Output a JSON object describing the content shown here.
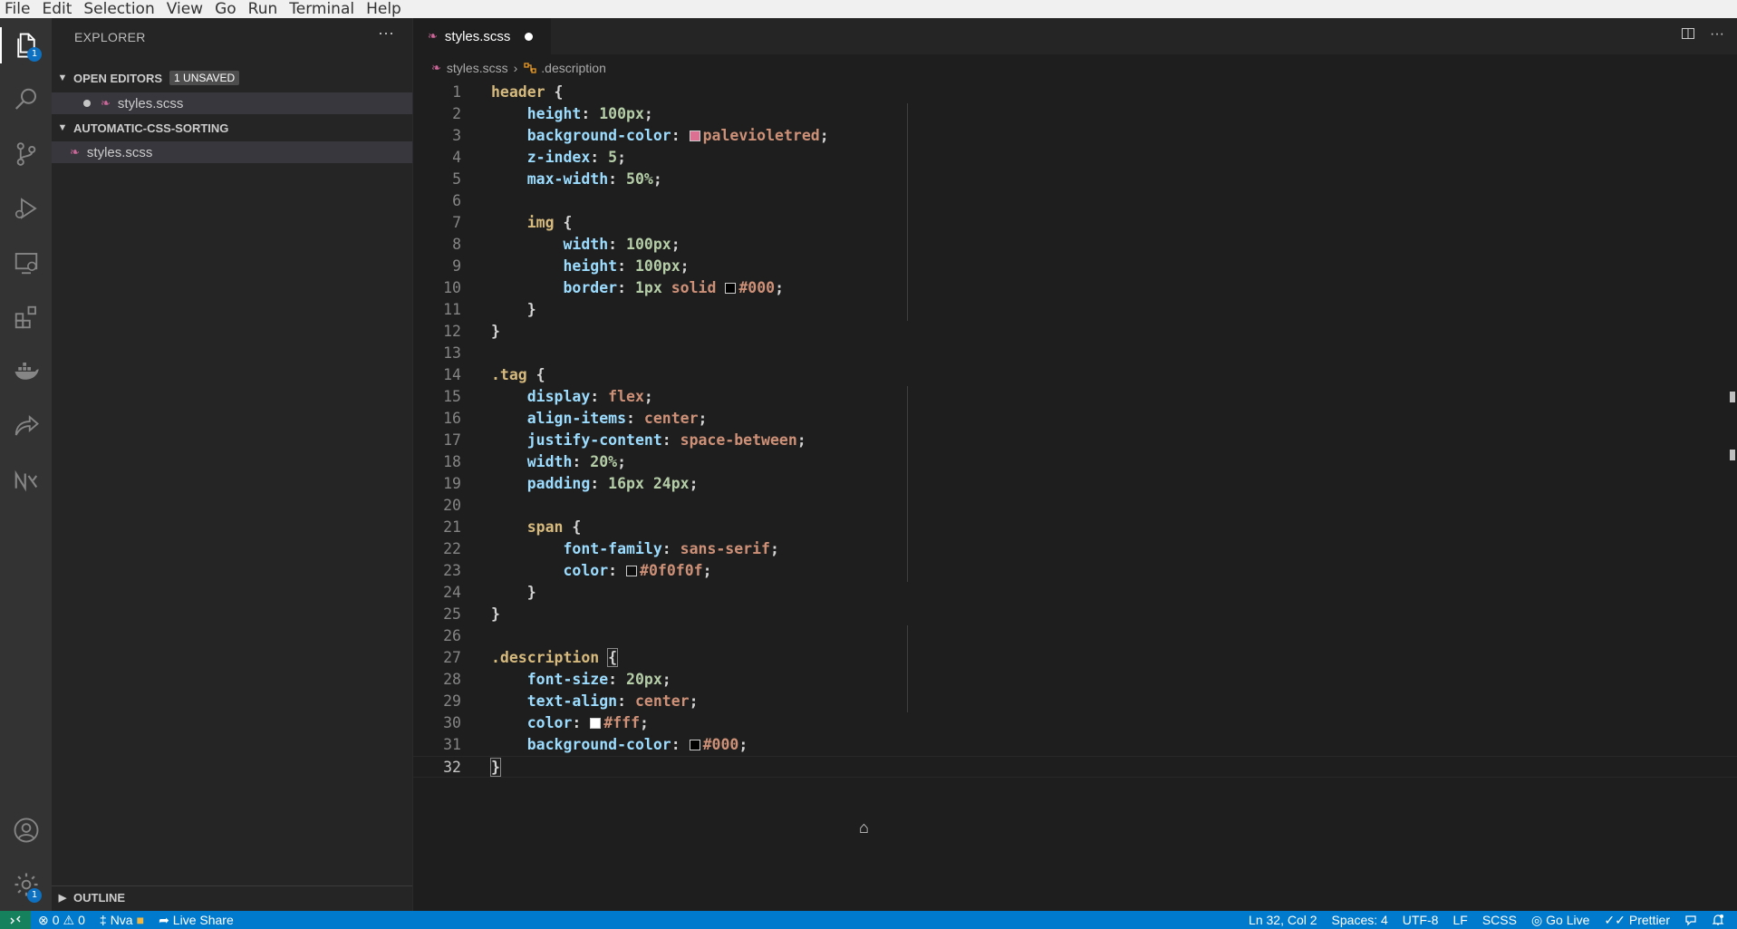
{
  "menu": [
    "File",
    "Edit",
    "Selection",
    "View",
    "Go",
    "Run",
    "Terminal",
    "Help"
  ],
  "activity": {
    "explorer_badge": "1",
    "settings_badge": "1"
  },
  "sidebar": {
    "title": "EXPLORER",
    "more": "···",
    "open_editors": {
      "label": "OPEN EDITORS",
      "badge": "1 UNSAVED",
      "files": [
        "styles.scss"
      ]
    },
    "folder": {
      "label": "AUTOMATIC-CSS-SORTING",
      "files": [
        "styles.scss"
      ]
    },
    "outline_label": "OUTLINE"
  },
  "tab": {
    "filename": "styles.scss"
  },
  "breadcrumb": {
    "file": "styles.scss",
    "symbol": ".description"
  },
  "colors": {
    "palevioletred": "#db7093",
    "black": "#000000",
    "near_black": "#0f0f0f",
    "white": "#ffffff",
    "statusbar": "#007acc",
    "remote": "#16825d"
  },
  "code_lines": [
    "1",
    "2",
    "3",
    "4",
    "5",
    "6",
    "7",
    "8",
    "9",
    "10",
    "11",
    "12",
    "13",
    "14",
    "15",
    "16",
    "17",
    "18",
    "19",
    "20",
    "21",
    "22",
    "23",
    "24",
    "25",
    "26",
    "27",
    "28",
    "29",
    "30",
    "31",
    "32"
  ],
  "code": {
    "l1_sel": "header",
    "l2_prop": "height",
    "l2_val": "100px",
    "l3_prop": "background-color",
    "l3_val": "palevioletred",
    "l4_prop": "z-index",
    "l4_val": "5",
    "l5_prop": "max-width",
    "l5_val": "50%",
    "l7_sel": "img",
    "l8_prop": "width",
    "l8_val": "100px",
    "l9_prop": "height",
    "l9_val": "100px",
    "l10_prop": "border",
    "l10_num": "1px",
    "l10_kw": "solid",
    "l10_col": "#000",
    "l14_sel": ".tag",
    "l15_prop": "display",
    "l15_val": "flex",
    "l16_prop": "align-items",
    "l16_val": "center",
    "l17_prop": "justify-content",
    "l17_val": "space-between",
    "l18_prop": "width",
    "l18_val": "20%",
    "l19_prop": "padding",
    "l19_val": "16px 24px",
    "l21_sel": "span",
    "l22_prop": "font-family",
    "l22_val": "sans-serif",
    "l23_prop": "color",
    "l23_val": "#0f0f0f",
    "l27_sel": ".description",
    "l28_prop": "font-size",
    "l28_val": "20px",
    "l29_prop": "text-align",
    "l29_val": "center",
    "l30_prop": "color",
    "l30_val": "#fff",
    "l31_prop": "background-color",
    "l31_val": "#000"
  },
  "status": {
    "errors": "0",
    "warnings": "0",
    "user": "Nva",
    "live_share": "Live Share",
    "position": "Ln 32, Col 2",
    "spaces": "Spaces: 4",
    "encoding": "UTF-8",
    "eol": "LF",
    "language": "SCSS",
    "go_live": "Go Live",
    "prettier": "Prettier"
  }
}
